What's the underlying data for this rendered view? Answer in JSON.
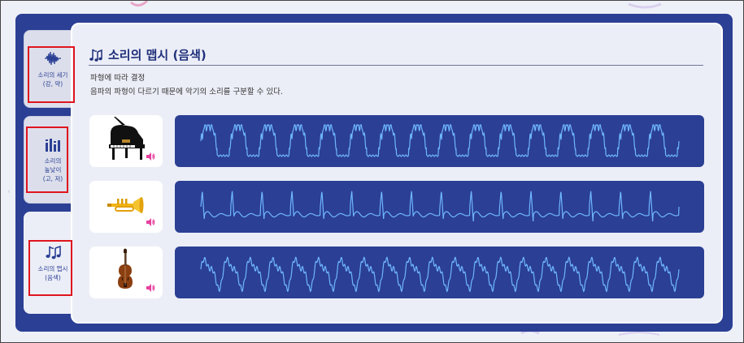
{
  "sidebar": {
    "tabs": [
      {
        "label_line1": "소리의 세기",
        "label_line2": "(강, 약)",
        "icon": "waveform-icon",
        "active": false
      },
      {
        "label_line1": "소리의",
        "label_line2": "높낮이",
        "label_line3": "(고, 저)",
        "icon": "equalizer-bars-icon",
        "active": false
      },
      {
        "label_line1": "소리의 맵시",
        "label_line2": "(음색)",
        "icon": "music-note-icon",
        "active": true
      }
    ]
  },
  "main": {
    "title": "소리의 맵시 (음색)",
    "title_icon": "music-note-icon",
    "desc_line1": "파형에 따라 결정",
    "desc_line2": "음파의 파형이 다르기 때문에 악기의 소리를 구분할 수 있다.",
    "instruments": [
      {
        "name": "piano",
        "icon": "grand-piano-icon",
        "speaker_icon": "speaker-icon",
        "waveform": "piano"
      },
      {
        "name": "trumpet",
        "icon": "trumpet-icon",
        "speaker_icon": "speaker-icon",
        "waveform": "trumpet"
      },
      {
        "name": "violin",
        "icon": "violin-icon",
        "speaker_icon": "speaker-icon",
        "waveform": "violin"
      }
    ]
  },
  "colors": {
    "panel": "#2b3f94",
    "content_bg": "#eceef7",
    "wave_line": "#6fb6ff",
    "speaker": "#e83f9e",
    "highlight_box": "#e0141e",
    "title": "#1f2f7a"
  }
}
